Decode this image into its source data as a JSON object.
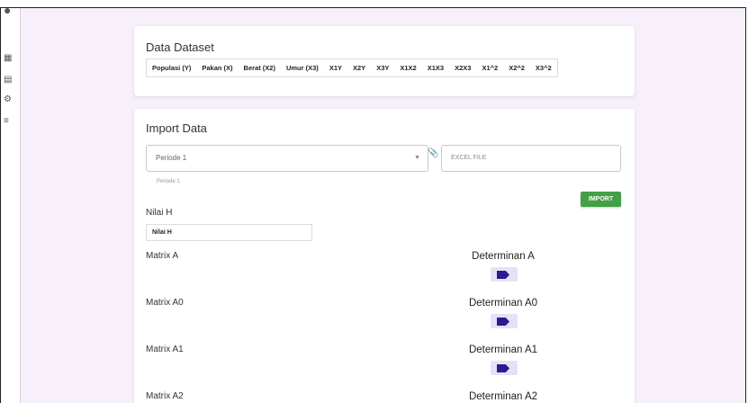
{
  "dataset": {
    "title": "Data Dataset",
    "columns": [
      "Populasi (Y)",
      "Pakan (X)",
      "Berat (X2)",
      "Umur (X3)",
      "X1Y",
      "X2Y",
      "X3Y",
      "X1X2",
      "X1X3",
      "X2X3",
      "X1^2",
      "X2^2",
      "X3^2"
    ]
  },
  "import": {
    "title": "Import Data",
    "periode_value": "Periode 1",
    "periode_hint": "Periode 1",
    "file_placeholder": "EXCEL FILE",
    "import_label": "IMPORT"
  },
  "nilai": {
    "label": "Nilai H",
    "input_value": "Nilai H"
  },
  "matrices": [
    {
      "label": "Matrix A",
      "det_label": "Determinan A"
    },
    {
      "label": "Matrix A0",
      "det_label": "Determinan A0"
    },
    {
      "label": "Matrix A1",
      "det_label": "Determinan A1"
    },
    {
      "label": "Matrix A2",
      "det_label": "Determinan A2"
    }
  ],
  "colors": {
    "accent": "#2e1a8f",
    "import_button": "#43a047",
    "background": "#f7effa"
  },
  "icons": [
    "user-icon",
    "table-icon",
    "document-icon",
    "gear-icon",
    "code-icon",
    "paperclip-icon",
    "tag-icon"
  ]
}
